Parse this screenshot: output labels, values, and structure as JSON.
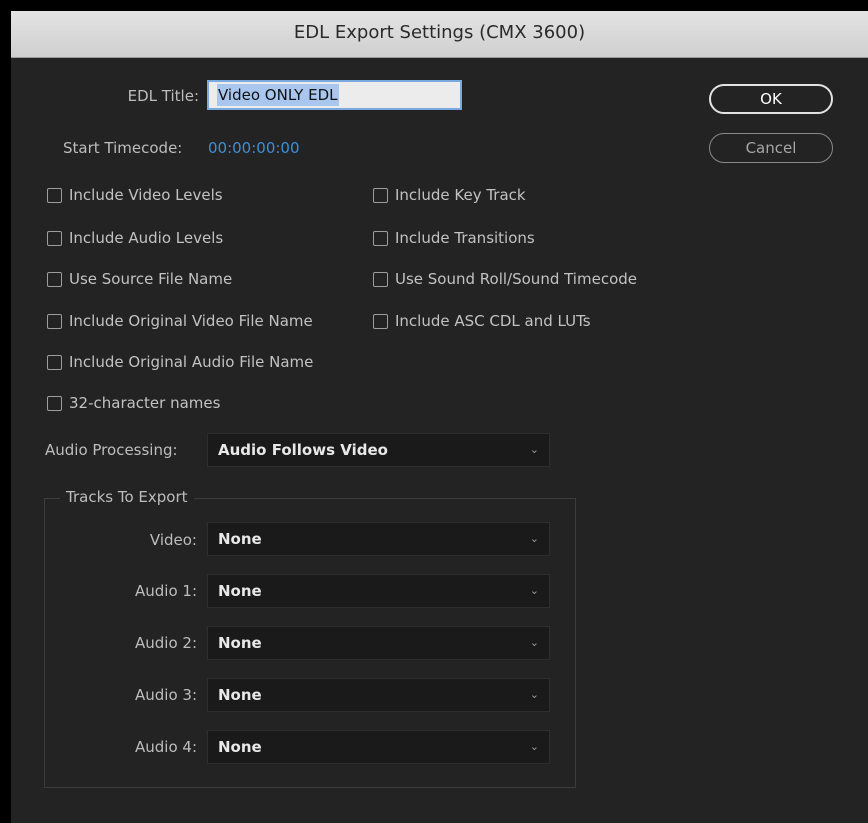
{
  "window": {
    "title": "EDL Export Settings (CMX 3600)"
  },
  "edl_title": {
    "label": "EDL Title:",
    "value": "Video ONLY EDL"
  },
  "start_timecode": {
    "label": "Start Timecode:",
    "value": "00:00:00:00"
  },
  "buttons": {
    "ok": "OK",
    "cancel": "Cancel"
  },
  "options_left": [
    {
      "label": "Include Video Levels",
      "checked": false
    },
    {
      "label": "Include Audio Levels",
      "checked": false
    },
    {
      "label": "Use Source File Name",
      "checked": false
    },
    {
      "label": "Include Original Video File Name",
      "checked": false
    },
    {
      "label": "Include Original Audio File Name",
      "checked": false
    },
    {
      "label": "32-character names",
      "checked": false
    }
  ],
  "options_right": [
    {
      "label": "Include Key Track",
      "checked": false
    },
    {
      "label": "Include Transitions",
      "checked": false
    },
    {
      "label": "Use Sound Roll/Sound Timecode",
      "checked": false
    },
    {
      "label": "Include ASC CDL and LUTs",
      "checked": false
    }
  ],
  "audio_processing": {
    "label": "Audio Processing:",
    "value": "Audio Follows Video"
  },
  "tracks": {
    "legend": "Tracks To Export",
    "rows": [
      {
        "label": "Video:",
        "value": "None"
      },
      {
        "label": "Audio 1:",
        "value": "None"
      },
      {
        "label": "Audio 2:",
        "value": "None"
      },
      {
        "label": "Audio 3:",
        "value": "None"
      },
      {
        "label": "Audio 4:",
        "value": "None"
      }
    ]
  },
  "colors": {
    "accent_timecode": "#3c8fd8",
    "selection": "#a9c6ee",
    "dialog_bg": "#232323"
  },
  "icons": {
    "dropdown": "chevron-down-icon",
    "checkbox": "checkbox-unchecked-icon"
  }
}
